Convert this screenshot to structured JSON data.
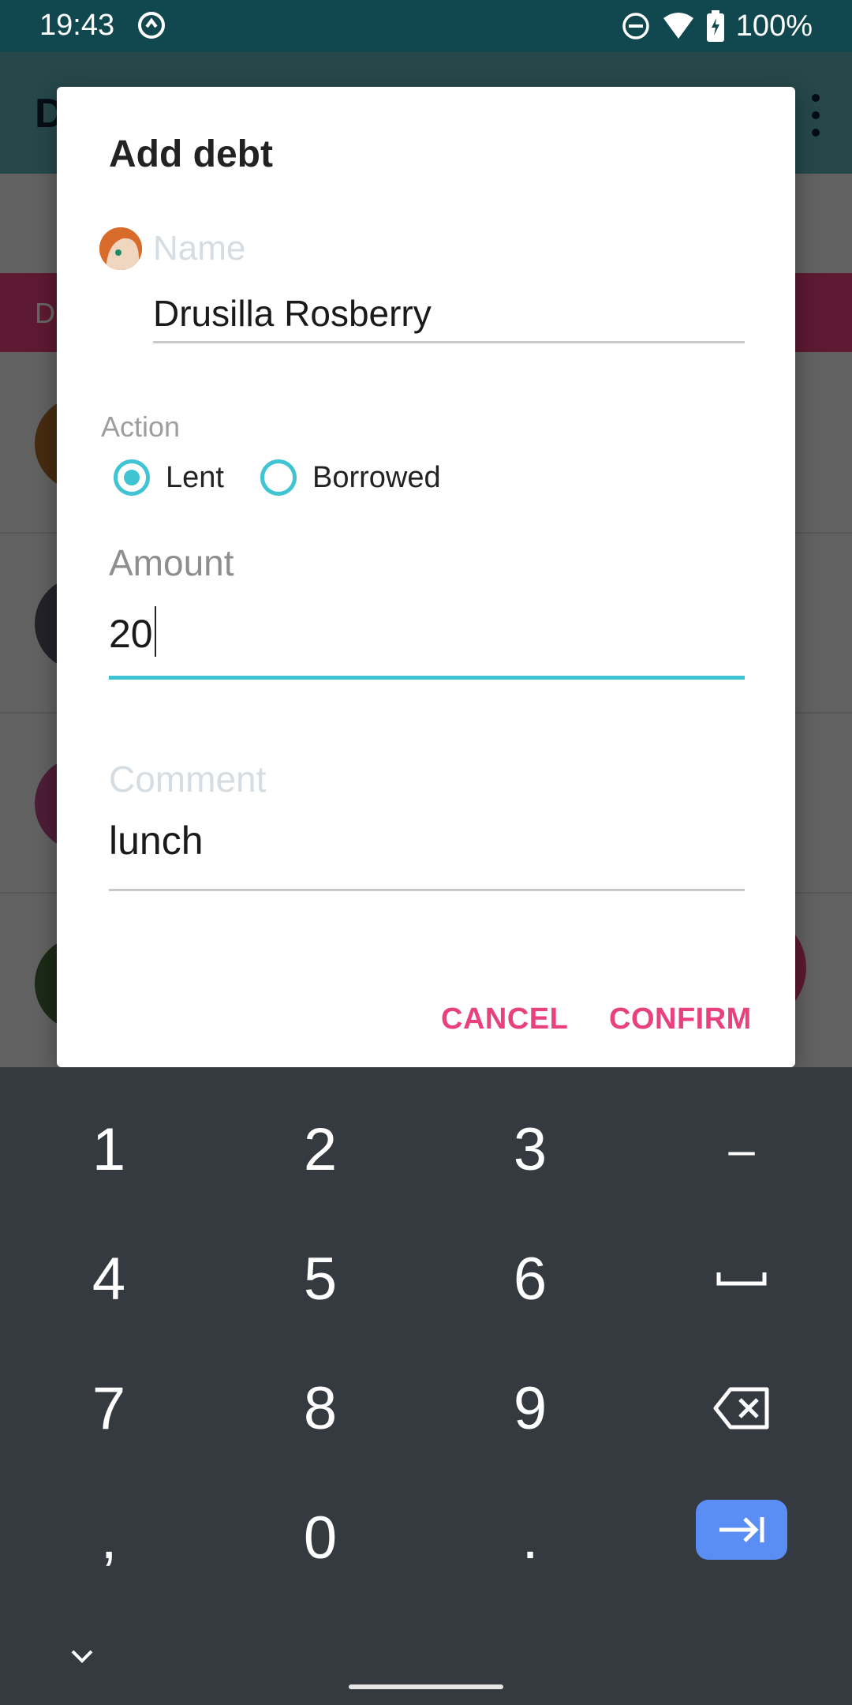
{
  "status_bar": {
    "time": "19:43",
    "battery": "100%",
    "icons": [
      "q-notification-icon",
      "do-not-disturb-icon",
      "wifi-icon",
      "battery-charging-icon"
    ]
  },
  "background_app": {
    "title": "D",
    "strip_label": "D"
  },
  "dialog": {
    "title": "Add debt",
    "name": {
      "label": "Name",
      "value": "Drusilla Rosberry"
    },
    "action": {
      "label": "Action",
      "options": [
        {
          "label": "Lent",
          "selected": true
        },
        {
          "label": "Borrowed",
          "selected": false
        }
      ]
    },
    "amount": {
      "label": "Amount",
      "value": "20"
    },
    "comment": {
      "label": "Comment",
      "value": "lunch"
    },
    "buttons": {
      "cancel": "CANCEL",
      "confirm": "CONFIRM"
    }
  },
  "keyboard": {
    "rows": [
      [
        "1",
        "2",
        "3",
        "–"
      ],
      [
        "4",
        "5",
        "6",
        "space-icon"
      ],
      [
        "7",
        "8",
        "9",
        "backspace-icon"
      ],
      [
        ",",
        "0",
        ".",
        "next-icon"
      ]
    ]
  },
  "colors": {
    "accent": "#40c4d4",
    "action": "#e8417e",
    "status_bar": "#11474f",
    "keyboard_bg": "#353a40",
    "enter_key": "#5b8ef5"
  }
}
